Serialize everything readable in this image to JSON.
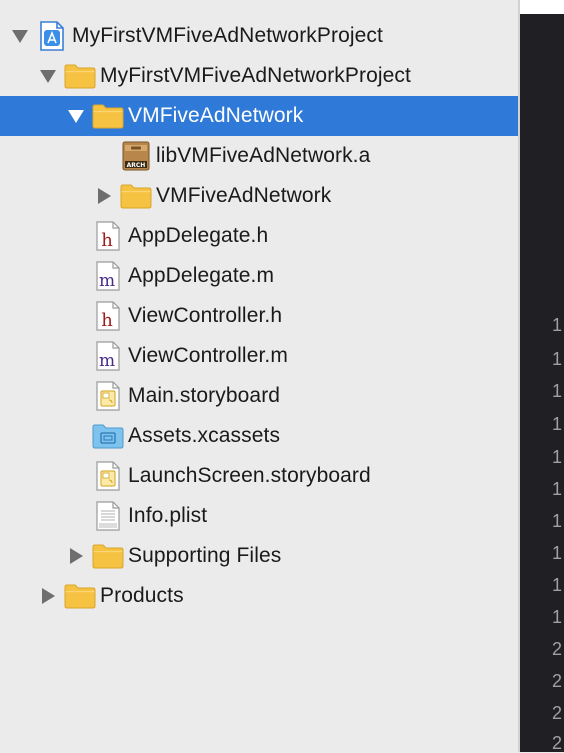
{
  "navigator": {
    "rows": [
      {
        "label": "MyFirstVMFiveAdNetworkProject",
        "icon": "xcode-project-icon",
        "disclosure": "expanded",
        "depth": 0
      },
      {
        "label": "MyFirstVMFiveAdNetworkProject",
        "icon": "folder-icon",
        "disclosure": "expanded",
        "depth": 1
      },
      {
        "label": "VMFiveAdNetwork",
        "icon": "folder-icon",
        "disclosure": "expanded",
        "depth": 2,
        "selected": true
      },
      {
        "label": "libVMFiveAdNetwork.a",
        "icon": "archive-library-icon",
        "disclosure": "none",
        "depth": 3
      },
      {
        "label": "VMFiveAdNetwork",
        "icon": "folder-icon",
        "disclosure": "collapsed",
        "depth": 3
      },
      {
        "label": "AppDelegate.h",
        "icon": "header-file-icon",
        "disclosure": "none",
        "depth": 2
      },
      {
        "label": "AppDelegate.m",
        "icon": "objc-source-file-icon",
        "disclosure": "none",
        "depth": 2
      },
      {
        "label": "ViewController.h",
        "icon": "header-file-icon",
        "disclosure": "none",
        "depth": 2
      },
      {
        "label": "ViewController.m",
        "icon": "objc-source-file-icon",
        "disclosure": "none",
        "depth": 2
      },
      {
        "label": "Main.storyboard",
        "icon": "storyboard-file-icon",
        "disclosure": "none",
        "depth": 2
      },
      {
        "label": "Assets.xcassets",
        "icon": "asset-catalog-folder-icon",
        "disclosure": "none",
        "depth": 2
      },
      {
        "label": "LaunchScreen.storyboard",
        "icon": "storyboard-file-icon",
        "disclosure": "none",
        "depth": 2
      },
      {
        "label": "Info.plist",
        "icon": "plist-file-icon",
        "disclosure": "none",
        "depth": 2
      },
      {
        "label": "Supporting Files",
        "icon": "folder-icon",
        "disclosure": "collapsed",
        "depth": 2
      },
      {
        "label": "Products",
        "icon": "folder-icon",
        "disclosure": "collapsed",
        "depth": 1
      }
    ]
  },
  "editor": {
    "gutter_digits": [
      "1",
      "1",
      "1",
      "1",
      "1",
      "1",
      "1",
      "1",
      "1",
      "1",
      "2",
      "2",
      "2",
      "2"
    ]
  },
  "colors": {
    "selection": "#2f7ad9",
    "folder": "#f5c242",
    "editor_background": "#1f1f24"
  }
}
